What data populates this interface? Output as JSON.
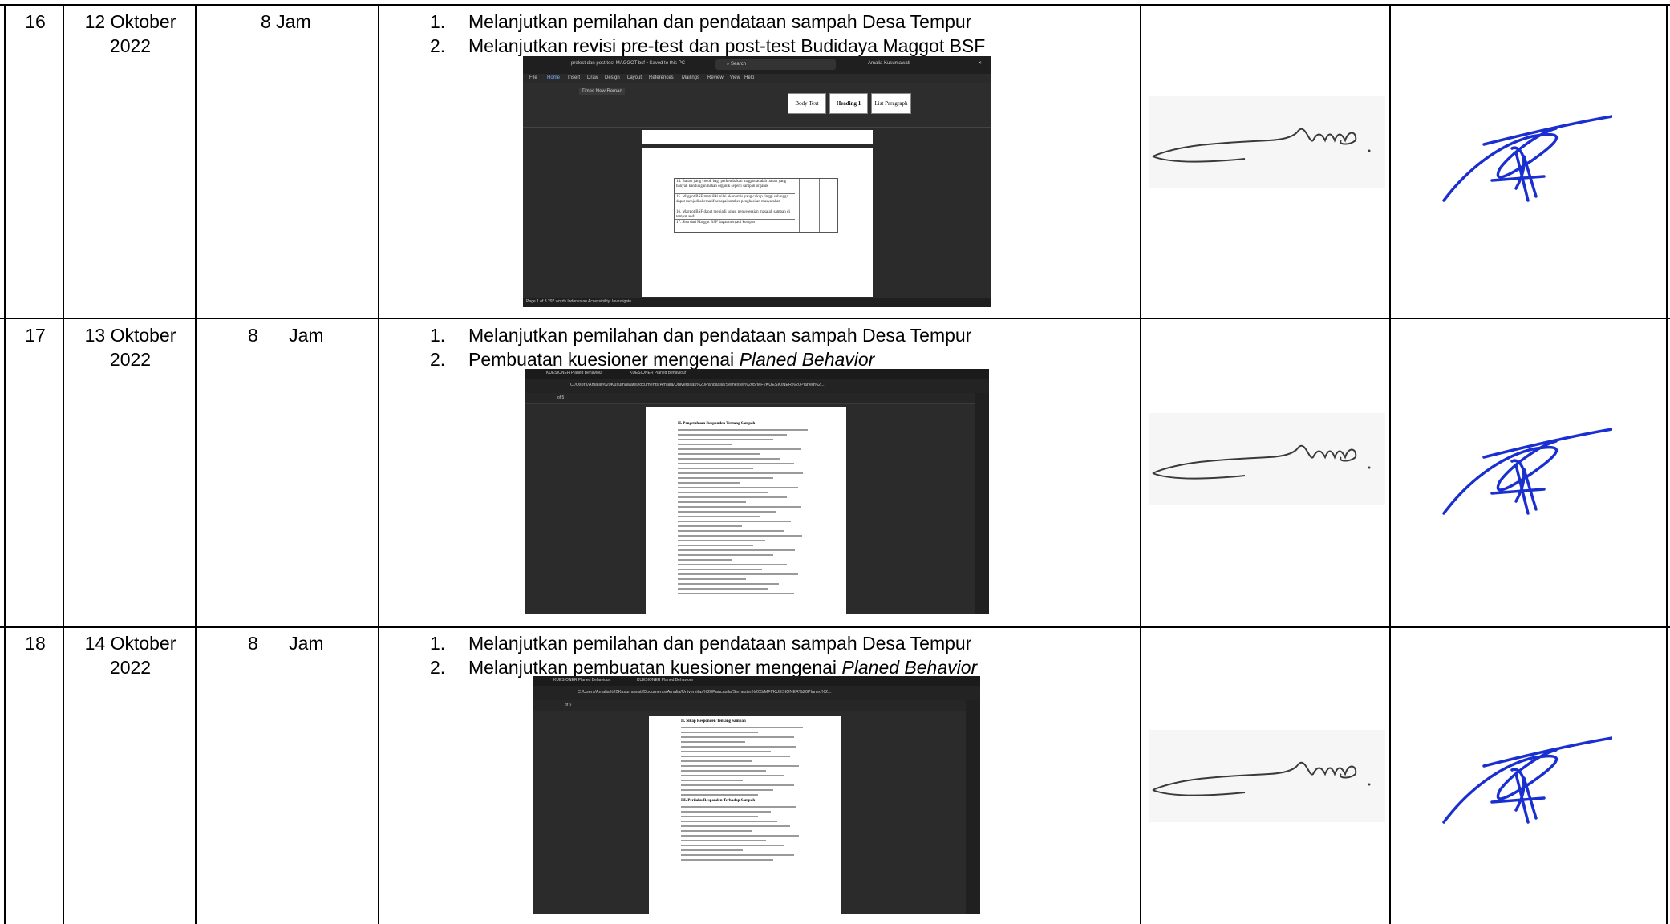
{
  "rows": [
    {
      "no": "16",
      "date": "12 Oktober\n2022",
      "duration": "8 Jam",
      "tasks": [
        {
          "num": "1.",
          "text": "Melanjutkan pemilahan dan pendataan sampah Desa Tempur",
          "italic": ""
        },
        {
          "num": "2.",
          "text": "Melanjutkan revisi pre-test dan post-test Budidaya Maggot BSF",
          "italic": ""
        }
      ],
      "screenshot": {
        "type": "word",
        "title": "prelest dan post test MAGGOT bsf • Saved to this PC",
        "search": "Search",
        "user": "Amalia Kusumawati",
        "menu": [
          "File",
          "Home",
          "Insert",
          "Draw",
          "Design",
          "Layout",
          "References",
          "Mailings",
          "Review",
          "View",
          "Help"
        ],
        "styles": [
          "Body Text",
          "Heading 1",
          "List Paragraph"
        ],
        "font": "Times New Roman",
        "doc_items": [
          "14. Bahan yang cocok bagi perkembakan maggot adalah bahan yang banyak kandungan bahan organik seperti sampah organik",
          "15. Maggot BSF memiliki nilai ekonomis yang cukup tinggi sehingga dapat menjadi alternatif sebagai sumber penghasilan masyarakat",
          "16. Maggot BSF dapat menjadi solusi penyelesaian masalah sampah di tempat anda",
          "17. Sisa dari Maggot BSF dapat menjadi kompos"
        ],
        "status": "Page 1 of 3   297 words   Indonesian   Accessibility: Investigate"
      }
    },
    {
      "no": "17",
      "date": "13 Oktober\n2022",
      "duration": "8      Jam",
      "tasks": [
        {
          "num": "1.",
          "text": "Melanjutkan pemilahan dan pendataan sampah Desa Tempur",
          "italic": ""
        },
        {
          "num": "2.",
          "text": "Pembuatan kuesioner mengenai ",
          "italic": "Planed Behavior"
        }
      ],
      "screenshot": {
        "type": "pdf",
        "tab": "KUESIONER Planed Behaviour",
        "url": "C:/Users/Amalia%20Kusumawati/Documents/Amalia/Universitas%20Pancasila/Semester%205/MFI/KUESIONER%20Planed%2...",
        "page_info": "of 5",
        "heading": "II. Pengetahuan Responden Tentang Sampah"
      }
    },
    {
      "no": "18",
      "date": "14 Oktober\n2022",
      "duration": "8      Jam",
      "tasks": [
        {
          "num": "1.",
          "text": "Melanjutkan pemilahan dan pendataan sampah Desa Tempur",
          "italic": ""
        },
        {
          "num": "2.",
          "text": "Melanjutkan pembuatan kuesioner mengenai ",
          "italic": "Planed Behavior"
        }
      ],
      "screenshot": {
        "type": "pdf",
        "tab": "KUESIONER Planed Behaviour",
        "url": "C:/Users/Amalia%20Kusumawati/Documents/Amalia/Universitas%20Pancasila/Semester%205/MFI/KUESIONER%20Planed%2...",
        "page_info": "of 5",
        "heading": "II. Sikap Responden Tentang Sampah",
        "heading2": "III. Perilaku Responden Terhadap Sampah"
      }
    }
  ],
  "colors": {
    "border": "#000000",
    "signature_ink": "#1a2fd0",
    "signature_gray": "#3a3a3a"
  }
}
